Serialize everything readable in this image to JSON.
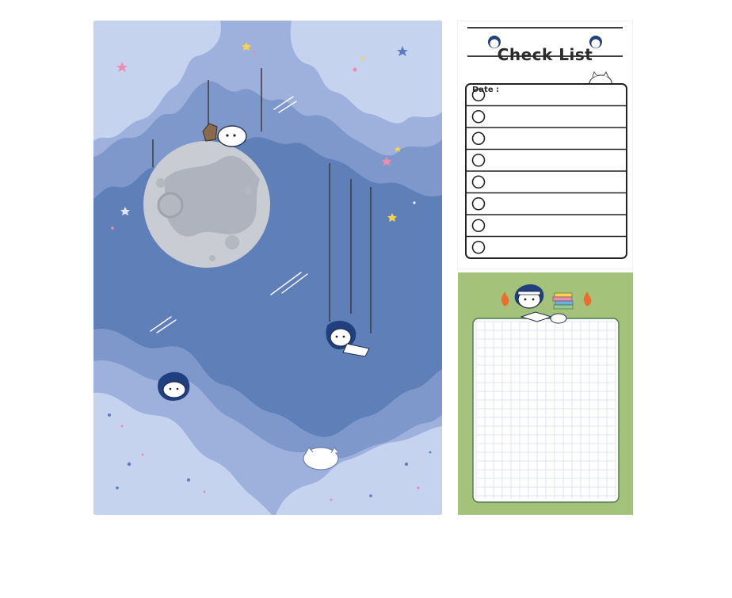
{
  "checklist": {
    "title": "Check List",
    "date_label": "Date :",
    "rows": 8
  },
  "colors": {
    "sky": "#5e7fb8",
    "cloud_light": "#c5d3ee",
    "cloud_mid": "#9db1dc",
    "cloud_deep": "#7e98cc",
    "moon": "#c9ccd3",
    "grid_green": "#a4c27a",
    "grid_line": "#d4dcea",
    "flame": "#ef6b2f",
    "star_pink": "#f08ab0",
    "star_yellow": "#f5d34a",
    "star_blue": "#5b7bc2"
  },
  "icons": [
    "moon",
    "star",
    "shooting-star",
    "cartoon-character",
    "flame",
    "books",
    "notebook"
  ]
}
